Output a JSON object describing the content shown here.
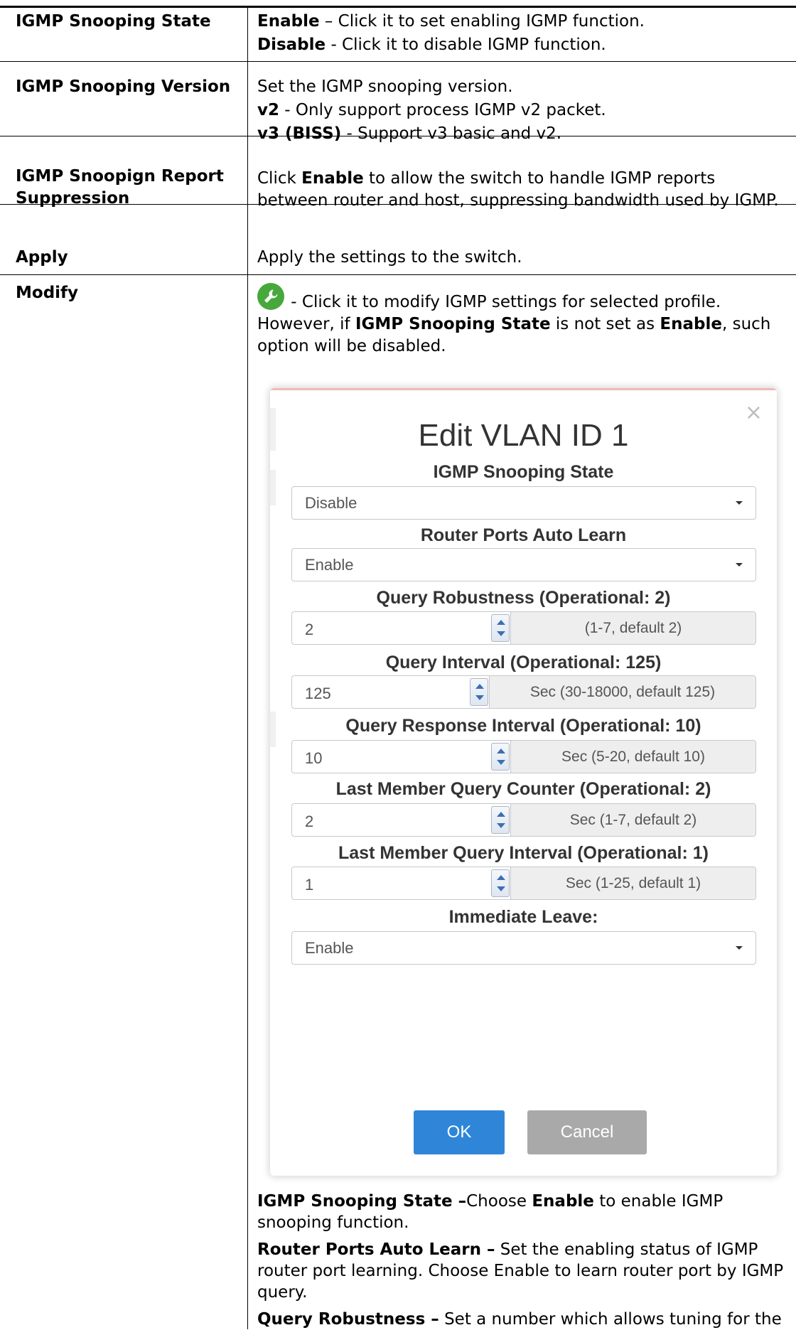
{
  "rows": [
    {
      "label": "IGMP Snooping State",
      "lines": [
        {
          "bold": "Enable",
          "text": " – Click it to set enabling IGMP function."
        },
        {
          "bold": "Disable",
          "text": " - Click it to disable IGMP function."
        }
      ]
    },
    {
      "label": "IGMP Snooping Version",
      "lines": [
        {
          "bold": "",
          "text": "Set the IGMP snooping version."
        },
        {
          "bold": "v2",
          "text": " - Only support process IGMP v2 packet."
        },
        {
          "bold": "v3 (BISS)",
          "text": " - Support v3 basic and v2."
        }
      ]
    },
    {
      "label": "IGMP Snoopign Report Suppression",
      "pre": "Click ",
      "bold": "Enable",
      "post": " to allow the switch to handle IGMP reports between router and host, suppressing bandwidth used by IGMP."
    },
    {
      "label": "Apply",
      "text": "Apply the settings to the switch."
    },
    {
      "label": "Modify",
      "icon": "wrench-icon",
      "icon_color": "#47a83c",
      "t1": " - Click it to modify IGMP settings for selected profile. However, if ",
      "b1": "IGMP Snooping State",
      "t2": " is not set as ",
      "b2": "Enable",
      "t3": ", such option will be disabled."
    }
  ],
  "dialog": {
    "title": "Edit VLAN ID 1",
    "close": "×",
    "fields": [
      {
        "label": "IGMP Snooping State",
        "type": "select",
        "value": "Disable"
      },
      {
        "label": "Router Ports Auto Learn",
        "type": "select",
        "value": "Enable"
      },
      {
        "label": "Query Robustness (Operational: 2)",
        "type": "number",
        "value": "2",
        "addon": "(1-7, default 2)"
      },
      {
        "label": "Query Interval (Operational: 125)",
        "type": "number",
        "value": "125",
        "addon": "Sec (30-18000, default 125)"
      },
      {
        "label": "Query Response Interval (Operational: 10)",
        "type": "number",
        "value": "10",
        "addon": "Sec (5-20, default 10)"
      },
      {
        "label": "Last Member Query Counter (Operational: 2)",
        "type": "number",
        "value": "2",
        "addon": "Sec (1-7, default 2)"
      },
      {
        "label": "Last Member Query Interval (Operational: 1)",
        "type": "number",
        "value": "1",
        "addon": "Sec (1-25, default 1)"
      },
      {
        "label": "Immediate Leave:",
        "type": "select",
        "value": "Enable"
      }
    ],
    "ok": "OK",
    "cancel": "Cancel",
    "ok_color": "#2f86d8",
    "cancel_color": "#a9a9a9"
  },
  "after": [
    {
      "bold": "IGMP Snooping State –",
      "text": "Choose ",
      "bold2": "Enable",
      "text2": " to enable IGMP snooping function."
    },
    {
      "bold": "Router Ports Auto Learn –",
      "text": " Set the enabling status of IGMP router port learning. Choose Enable to learn router port by IGMP query."
    },
    {
      "bold": "Query Robustness –",
      "text": " Set a number which allows tuning for the"
    }
  ]
}
